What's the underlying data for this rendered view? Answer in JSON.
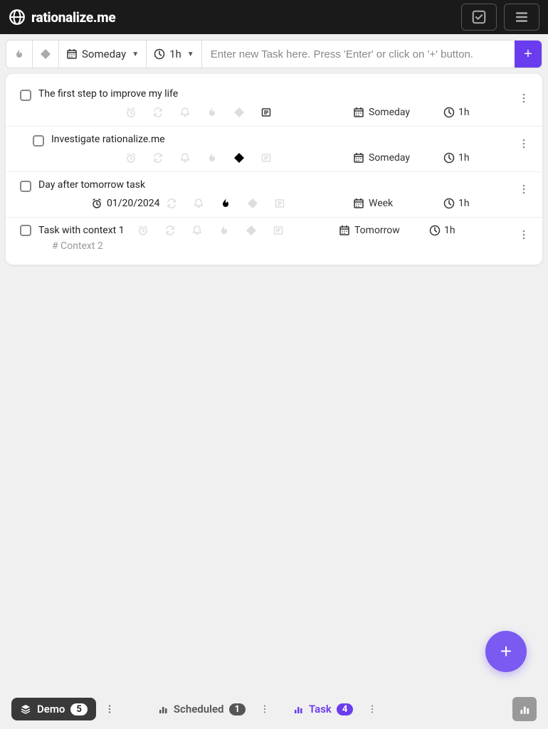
{
  "header": {
    "brand": "rationalize.me"
  },
  "toolbar": {
    "schedule_label": "Someday",
    "duration_label": "1h",
    "input_placeholder": "Enter new Task here. Press 'Enter' or click on '+' button."
  },
  "tasks": [
    {
      "title": "The first step to improve my life",
      "indented": false,
      "schedule": "Someday",
      "duration": "1h",
      "date": null,
      "icons": {
        "alarm": "dim",
        "repeat": "dim",
        "bell": "dim",
        "fire": "dim",
        "priority": "dim",
        "note": "dark"
      },
      "context": null
    },
    {
      "title": "Investigate rationalize.me",
      "indented": true,
      "schedule": "Someday",
      "duration": "1h",
      "date": null,
      "icons": {
        "alarm": "dim",
        "repeat": "dim",
        "bell": "dim",
        "fire": "dim",
        "priority": "black",
        "note": "dim"
      },
      "context": null
    },
    {
      "title": "Day after tomorrow task",
      "indented": false,
      "schedule": "Week",
      "duration": "1h",
      "date": "01/20/2024",
      "icons": {
        "alarm": "dark",
        "repeat": "dim",
        "bell": "dim",
        "fire": "black",
        "priority": "dim",
        "note": "dim"
      },
      "context": null
    },
    {
      "title": "Task with context 1",
      "indented": false,
      "schedule": "Tomorrow",
      "duration": "1h",
      "date": null,
      "inline": true,
      "icons": {
        "alarm": "dim",
        "repeat": "dim",
        "bell": "dim",
        "fire": "dim",
        "priority": "dim",
        "note": "dim"
      },
      "context": "# Context 2"
    }
  ],
  "bottom": {
    "demo_label": "Demo",
    "demo_count": "5",
    "scheduled_label": "Scheduled",
    "scheduled_count": "1",
    "task_label": "Task",
    "task_count": "4"
  }
}
